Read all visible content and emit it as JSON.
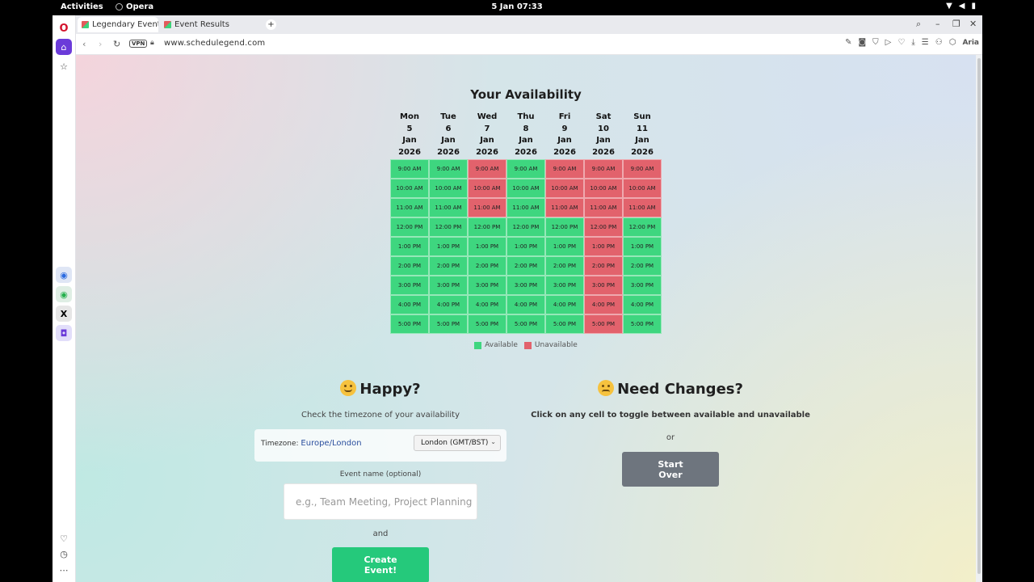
{
  "system": {
    "activities": "Activities",
    "app_name": "Opera",
    "clock": "5 Jan  07:33"
  },
  "browser": {
    "tabs": [
      {
        "label": "Legendary Event",
        "active": true
      },
      {
        "label": "Event Results",
        "active": false
      }
    ],
    "url": "www.schedulegend.com",
    "vpn_label": "VPN",
    "ai_label": "Aria"
  },
  "page": {
    "title": "Your Availability",
    "days": [
      {
        "dow": "Mon",
        "day": "5",
        "month": "Jan",
        "year": "2026"
      },
      {
        "dow": "Tue",
        "day": "6",
        "month": "Jan",
        "year": "2026"
      },
      {
        "dow": "Wed",
        "day": "7",
        "month": "Jan",
        "year": "2026"
      },
      {
        "dow": "Thu",
        "day": "8",
        "month": "Jan",
        "year": "2026"
      },
      {
        "dow": "Fri",
        "day": "9",
        "month": "Jan",
        "year": "2026"
      },
      {
        "dow": "Sat",
        "day": "10",
        "month": "Jan",
        "year": "2026"
      },
      {
        "dow": "Sun",
        "day": "11",
        "month": "Jan",
        "year": "2026"
      }
    ],
    "times": [
      "9:00 AM",
      "10:00 AM",
      "11:00 AM",
      "12:00 PM",
      "1:00 PM",
      "2:00 PM",
      "3:00 PM",
      "4:00 PM",
      "5:00 PM"
    ],
    "availability": [
      [
        1,
        1,
        0,
        1,
        0,
        0,
        0
      ],
      [
        1,
        1,
        0,
        1,
        0,
        0,
        0
      ],
      [
        1,
        1,
        0,
        1,
        0,
        0,
        0
      ],
      [
        1,
        1,
        1,
        1,
        1,
        0,
        1
      ],
      [
        1,
        1,
        1,
        1,
        1,
        0,
        1
      ],
      [
        1,
        1,
        1,
        1,
        1,
        0,
        1
      ],
      [
        1,
        1,
        1,
        1,
        1,
        0,
        1
      ],
      [
        1,
        1,
        1,
        1,
        1,
        0,
        1
      ],
      [
        1,
        1,
        1,
        1,
        1,
        0,
        1
      ]
    ],
    "legend": {
      "available": "Available",
      "unavailable": "Unavailable"
    },
    "colors": {
      "available": "#3ed67f",
      "unavailable": "#e2626c",
      "create_button": "#25c97b",
      "start_over_button": "#6e757e"
    },
    "happy": {
      "title": "Happy?",
      "subtitle": "Check the timezone of your availability",
      "timezone_label": "Timezone:",
      "timezone_value": "Europe/London",
      "timezone_select": "London (GMT/BST)",
      "event_name_label": "Event name (optional)",
      "event_name_placeholder": "e.g., Team Meeting, Project Planning",
      "and": "and",
      "create_button": "Create Event!"
    },
    "changes": {
      "title": "Need Changes?",
      "subtitle": "Click on any cell to toggle between available and unavailable",
      "or": "or",
      "start_over_button": "Start Over"
    }
  }
}
